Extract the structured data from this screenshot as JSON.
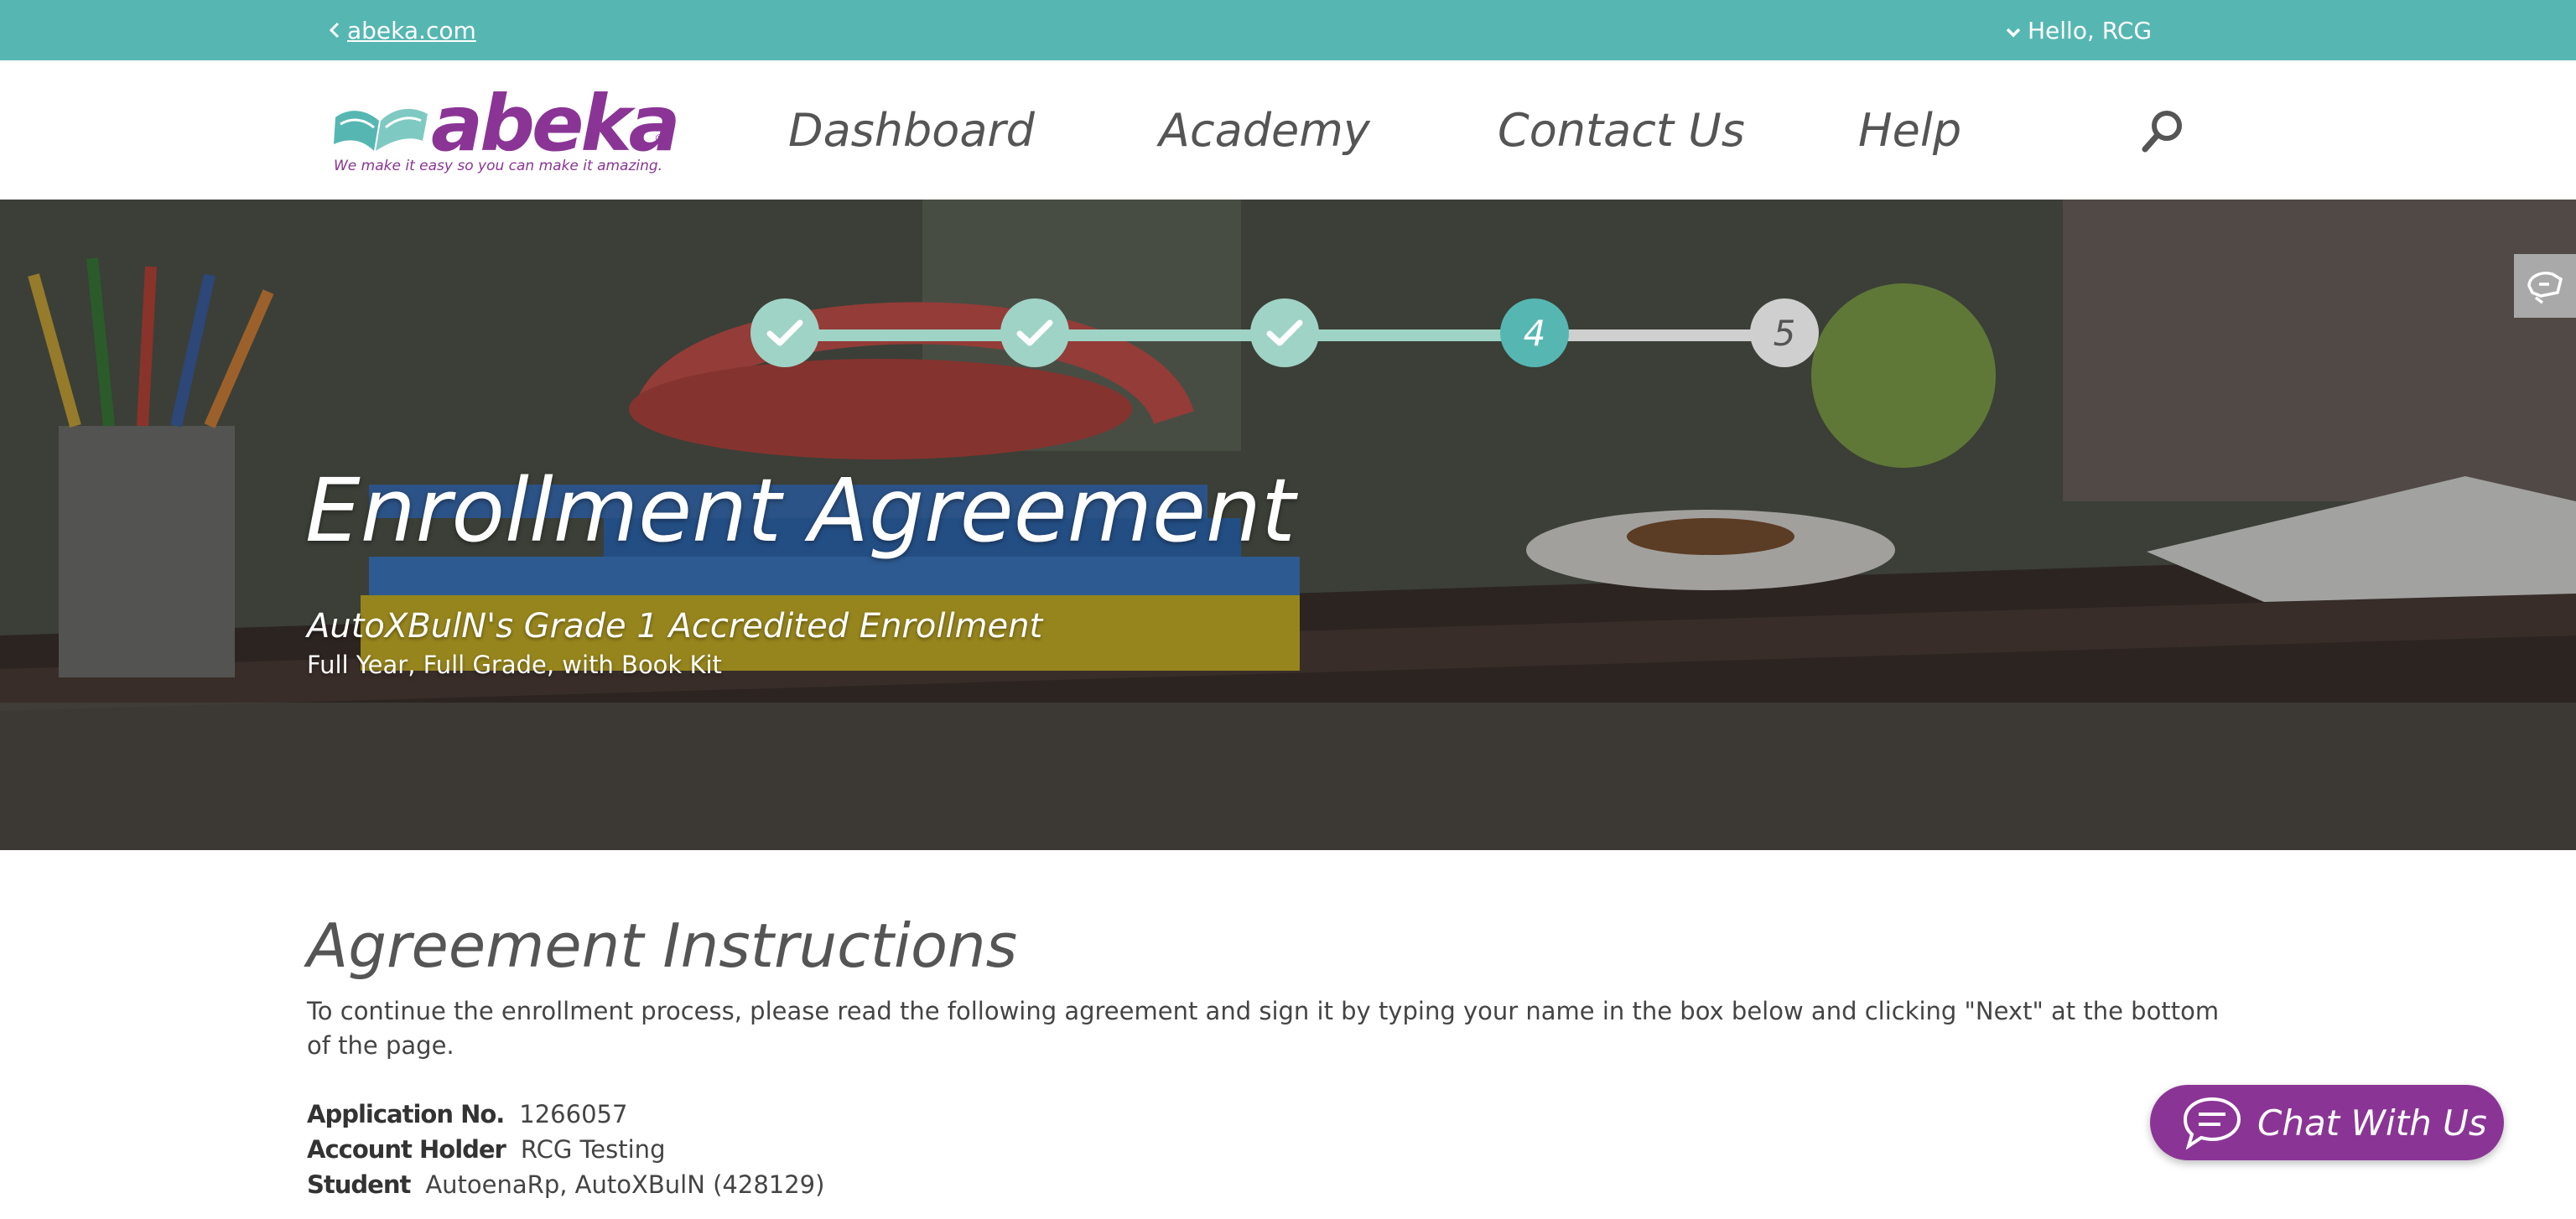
{
  "topbar": {
    "back_link": "abeka.com",
    "greeting": "Hello, RCG"
  },
  "logo": {
    "word": "abeka",
    "registered": "®",
    "tagline": "We make it easy so you can make it amazing."
  },
  "nav": {
    "items": [
      {
        "label": "Dashboard"
      },
      {
        "label": "Academy"
      },
      {
        "label": "Contact Us"
      },
      {
        "label": "Help"
      }
    ]
  },
  "progress": {
    "steps": [
      {
        "label": "",
        "state": "done"
      },
      {
        "label": "",
        "state": "done"
      },
      {
        "label": "",
        "state": "done"
      },
      {
        "label": "4",
        "state": "active"
      },
      {
        "label": "5",
        "state": "todo"
      }
    ]
  },
  "hero": {
    "title": "Enrollment Agreement",
    "subtitle": "AutoXBulN's Grade 1 Accredited Enrollment",
    "detail": "Full Year, Full Grade, with Book Kit"
  },
  "content": {
    "heading": "Agreement Instructions",
    "instructions": "To continue the enrollment process, please read the following agreement and sign it by typing your name in the box below and clicking \"Next\" at the bottom of the page.",
    "fields": [
      {
        "label": "Application No.",
        "value": "1266057"
      },
      {
        "label": "Account Holder",
        "value": "RCG Testing"
      },
      {
        "label": "Student",
        "value": "AutoenaRp, AutoXBulN (428129)"
      }
    ]
  },
  "chat": {
    "label": "Chat With Us"
  },
  "colors": {
    "teal": "#56b7b2",
    "purple": "#8a3595",
    "step_done": "#9fd3c6",
    "step_todo": "#cfcfcf"
  }
}
